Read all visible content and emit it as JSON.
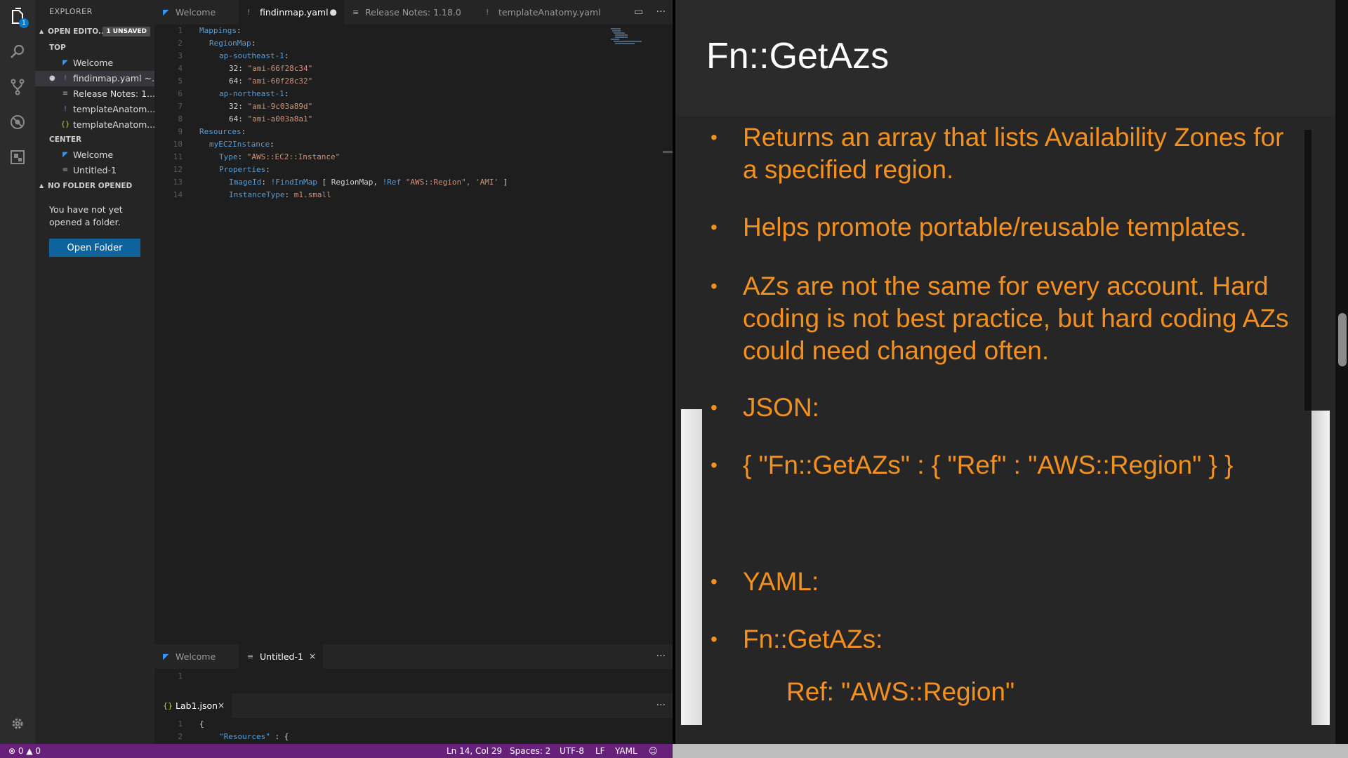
{
  "sidebar": {
    "title": "EXPLORER",
    "open_editors": {
      "label": "OPEN EDITO...",
      "badge": "1 UNSAVED",
      "groups": [
        {
          "label": "TOP",
          "items": [
            {
              "label": "Welcome",
              "icon": "vscode-icon"
            },
            {
              "label": "findinmap.yaml ~...",
              "icon": "yaml-icon",
              "unsaved": true
            },
            {
              "label": "Release Notes: 1....",
              "icon": "doc-icon"
            },
            {
              "label": "templateAnatom...",
              "icon": "yaml-icon"
            },
            {
              "label": "templateAnatom...",
              "icon": "json-icon"
            }
          ]
        },
        {
          "label": "CENTER",
          "items": [
            {
              "label": "Welcome",
              "icon": "vscode-icon"
            },
            {
              "label": "Untitled-1",
              "icon": "doc-icon"
            }
          ]
        }
      ]
    },
    "no_folder": {
      "label": "NO FOLDER OPENED",
      "message": "You have not yet opened a folder.",
      "button": "Open Folder"
    }
  },
  "activity": {
    "explorer_badge": "1",
    "icons": [
      "files-icon",
      "search-icon",
      "source-control-icon",
      "extensions-icon",
      "debug-icon",
      "gear-icon"
    ]
  },
  "editor_top": {
    "tabs": [
      {
        "label": "Welcome",
        "icon": "vscode-icon",
        "active": false
      },
      {
        "label": "findinmap.yaml",
        "icon": "yaml-icon",
        "active": true,
        "dirty_marker": "●"
      },
      {
        "label": "Release Notes: 1.18.0",
        "icon": "doc-icon",
        "active": false
      },
      {
        "label": "templateAnatomy.yaml",
        "icon": "yaml-icon",
        "active": false
      }
    ],
    "actions": [
      "split-editor-icon",
      "more-icon"
    ],
    "line_numbers": [
      "1",
      "2",
      "3",
      "4",
      "5",
      "6",
      "7",
      "8",
      "9",
      "10",
      "11",
      "12",
      "13",
      "14"
    ],
    "code": {
      "l1_key": "Mappings",
      "l2_key": "RegionMap",
      "l3_key": "ap-southeast-1",
      "l4_key": "32",
      "l4_val": "\"ami-66f28c34\"",
      "l5_key": "64",
      "l5_val": "\"ami-60f28c32\"",
      "l6_key": "ap-northeast-1",
      "l7_key": "32",
      "l7_val": "\"ami-9c03a89d\"",
      "l8_key": "64",
      "l8_val": "\"ami-a003a8a1\"",
      "l9_key": "Resources",
      "l10_key": "myEC2Instance",
      "l11_key": "Type",
      "l11_val": "\"AWS::EC2::Instance\"",
      "l12_key": "Properties",
      "l13_key": "ImageId",
      "l13_tag": "!FindInMap",
      "l13_open": "[",
      "l13_a1": "RegionMap,",
      "l13_ref": "!Ref",
      "l13_a2": "\"AWS::Region\",",
      "l13_a3": "'AMI'",
      "l13_close": "]",
      "l14_key": "InstanceType",
      "l14_val": "m1.small"
    }
  },
  "editor_mid": {
    "tabs": [
      {
        "label": "Welcome",
        "icon": "vscode-icon",
        "active": false
      },
      {
        "label": "Untitled-1",
        "icon": "doc-icon",
        "active": true,
        "close": "×"
      }
    ],
    "line_numbers": [
      "1"
    ]
  },
  "editor_bottom": {
    "tabs": [
      {
        "label": "Lab1.json",
        "icon": "json-icon",
        "active": true,
        "close": "×"
      }
    ],
    "line_numbers": [
      "1",
      "2"
    ],
    "code_l1": "{",
    "code_l2_key": "\"Resources\"",
    "code_l2_rest": " : {"
  },
  "statusbar": {
    "errors": "0",
    "warnings": "0",
    "position": "Ln 14, Col 29",
    "spaces": "Spaces: 2",
    "encoding": "UTF-8",
    "eol": "LF",
    "language": "YAML"
  },
  "slide": {
    "title": "Fn::GetAzs",
    "bullets": [
      "Returns an array that lists Availability Zones for a specified region.",
      "Helps promote portable/reusable templates.",
      "AZs are not the same for every account. Hard coding is not best practice, but hard coding AZs could need changed often.",
      "JSON:",
      "{ \"Fn::GetAZs\" : { \"Ref\" : \"AWS::Region\" } }",
      "YAML:",
      "Fn::GetAZs:"
    ],
    "sub_line": "Ref: \"AWS::Region\"",
    "bullet_char": "•",
    "colors": {
      "text": "#f39020",
      "title": "#ffffff",
      "background": "#262626"
    }
  }
}
